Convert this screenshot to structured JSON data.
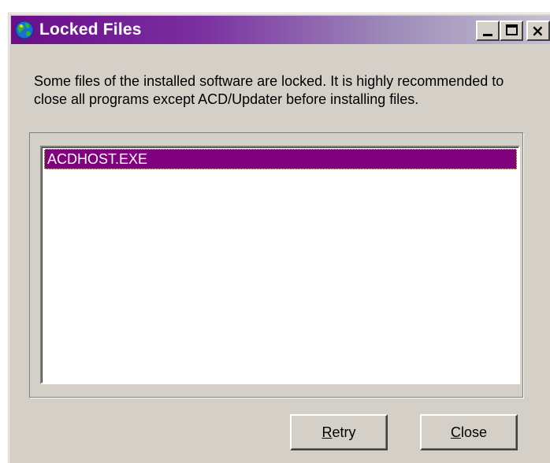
{
  "window": {
    "title": "Locked Files",
    "minimize_symbol": "",
    "maximize_symbol": "",
    "close_symbol": "×"
  },
  "message": "Some files of the installed software are locked. It is highly recommended to close all programs except ACD/Updater before installing files.",
  "locked_files": {
    "items": [
      "ACDHOST.EXE"
    ],
    "selected_index": 0
  },
  "buttons": {
    "retry": {
      "mnemonic": "R",
      "rest": "etry"
    },
    "close": {
      "mnemonic": "C",
      "rest": "lose"
    }
  },
  "colors": {
    "selection": "#800080",
    "titlebar_start": "#6a0d8a",
    "titlebar_end": "#c4c0d2",
    "dialog_face": "#d4d0c8"
  },
  "icons": {
    "app": "globe-icon",
    "minimize": "minimize-icon",
    "maximize": "maximize-icon",
    "close": "close-icon"
  }
}
